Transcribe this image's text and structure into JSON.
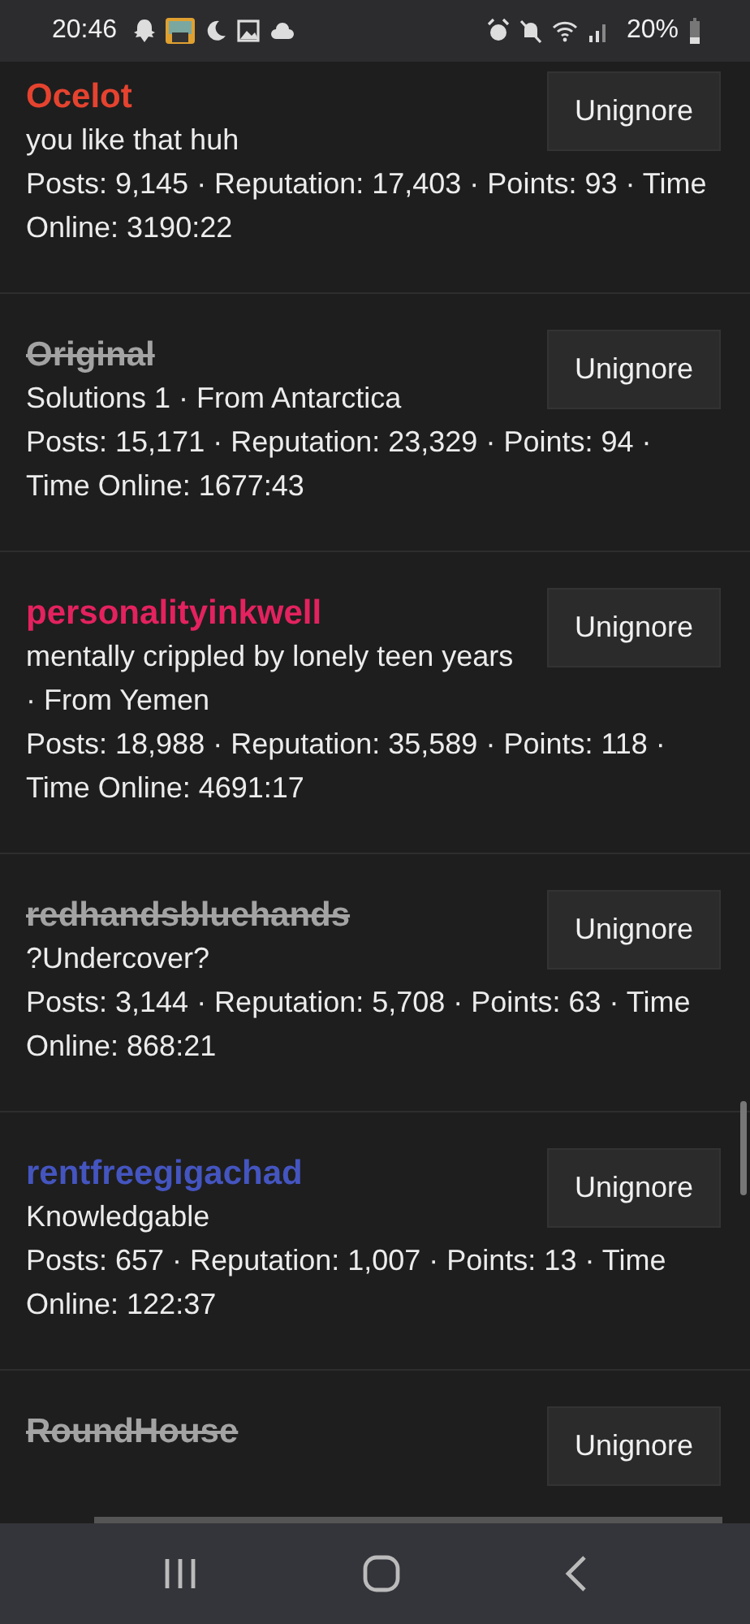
{
  "status_bar": {
    "time": "20:46",
    "battery": "20%"
  },
  "ignored_users": [
    {
      "name": "Ocelot",
      "color": "#e5432f",
      "struck": false,
      "subtitle": "you like that huh",
      "stats": "Posts: 9,145 · Reputation: 17,403 · Points: 93 · Time Online: 3190:22",
      "button": "Unignore"
    },
    {
      "name": "Original",
      "color": "#a3a3a3",
      "struck": true,
      "subtitle": "Solutions 1 · From Antarctica",
      "stats": "Posts: 15,171 · Reputation: 23,329 · Points: 94 · Time Online: 1677:43",
      "button": "Unignore"
    },
    {
      "name": "personalityinkwell",
      "color": "#e3225f",
      "struck": false,
      "subtitle": "mentally crippled by lonely teen years · From Yemen",
      "stats": "Posts: 18,988 · Reputation: 35,589 · Points: 118 · Time Online: 4691:17",
      "button": "Unignore"
    },
    {
      "name": "redhandsbluehands",
      "color": "#a3a3a3",
      "struck": true,
      "subtitle": "?Undercover?",
      "stats": "Posts: 3,144 · Reputation: 5,708 · Points: 63 · Time Online: 868:21",
      "button": "Unignore"
    },
    {
      "name": "rentfreegigachad",
      "color": "#4455c0",
      "struck": false,
      "subtitle": "Knowledgable",
      "stats": "Posts: 657 · Reputation: 1,007 · Points: 13 · Time Online: 122:37",
      "button": "Unignore"
    },
    {
      "name": "RoundHouse",
      "color": "#a3a3a3",
      "struck": true,
      "button": "Unignore"
    }
  ]
}
